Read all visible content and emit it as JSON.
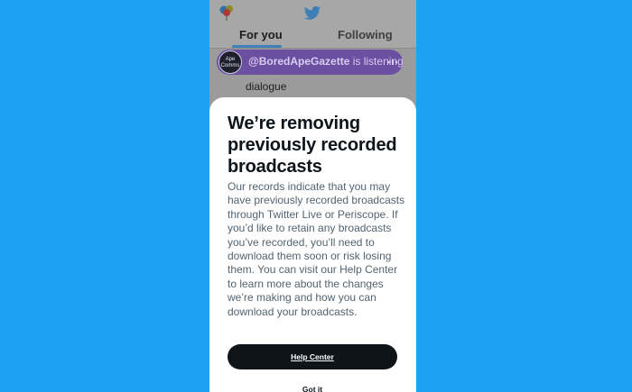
{
  "app": {
    "header": {
      "avatar_icon": "balloons-avatar-icon",
      "logo_icon": "twitter-bird-icon",
      "tabs": [
        {
          "label": "For you",
          "active": true
        },
        {
          "label": "Following",
          "active": false
        }
      ]
    },
    "spaces_bar": {
      "avatar_text_line1": "Ape",
      "avatar_text_line2": "Comms",
      "handle": "@BoredApeGazette",
      "status_text": " is listening",
      "audio_icon": "audio-wave-icon",
      "color": "#6b4fa1"
    },
    "feed_snippet": "dialogue"
  },
  "sheet": {
    "title": "We’re removing previously recorded broadcasts",
    "body": "Our records indicate that you may have previously recorded broadcasts through Twitter Live or Periscope. If you’d like to retain any broadcasts you’ve recorded, you’ll need to download them soon or risk losing them. You can visit our Help Center to learn more about the changes we’re making and how you can download your broadcasts.",
    "primary_button": "Help Center",
    "secondary_button": "Got it"
  },
  "colors": {
    "background": "#1da1f2",
    "title_text": "#0f1419",
    "body_text": "#536471",
    "primary_button": "#0f1419"
  }
}
